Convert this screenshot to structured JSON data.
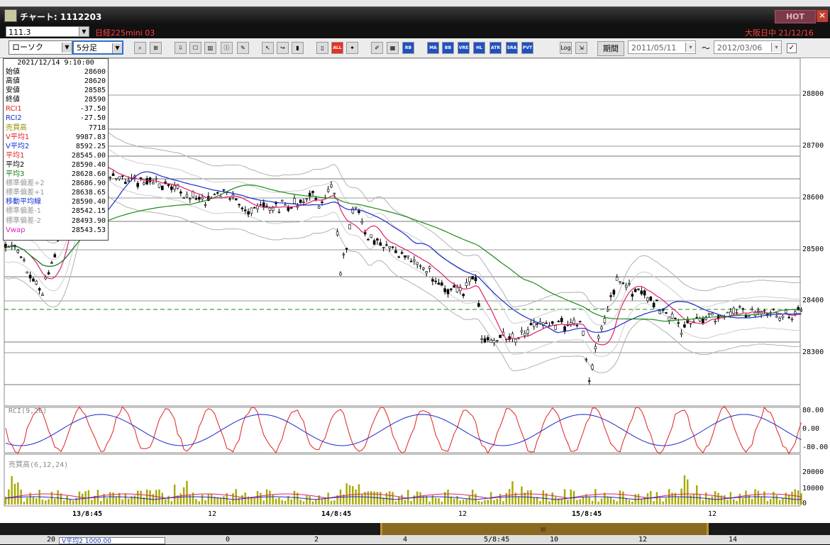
{
  "window": {
    "title": "チャート: 1112203",
    "hot_label": "HOT",
    "close_glyph": "✕"
  },
  "symbol_bar": {
    "code": "111.3",
    "name": "日経225mini 03",
    "market": "大阪日中  21/12/16"
  },
  "toolbar": {
    "chart_type": "ローソク",
    "interval": "5分足",
    "period_button": "期間",
    "start_date": "2011/05/11",
    "range_sep": "〜",
    "end_date": "2012/03/06",
    "buttons": [
      "zoom",
      "cross",
      "down",
      "cap",
      "up",
      "info",
      "edit",
      "pointer",
      "redo",
      "candle-a",
      "candle-b",
      "ALL",
      "config",
      "tools",
      "colors",
      "RCI",
      "MA",
      "BB",
      "VRE",
      "HL",
      "ATR",
      "SRA",
      "PVT",
      "Log",
      "export"
    ]
  },
  "info": {
    "datetime": "2021/12/14 9:10:00",
    "rows": [
      {
        "label": "始値",
        "value": "28600",
        "color": "black"
      },
      {
        "label": "高値",
        "value": "28620",
        "color": "black"
      },
      {
        "label": "安値",
        "value": "28585",
        "color": "black"
      },
      {
        "label": "終値",
        "value": "28590",
        "color": "black"
      },
      {
        "label": "RCI1",
        "value": "-37.50",
        "color": "red"
      },
      {
        "label": "RCI2",
        "value": "-27.50",
        "color": "blue"
      },
      {
        "label": "売買高",
        "value": "7718",
        "color": "olive"
      },
      {
        "label": "V平均1",
        "value": "9987.83",
        "color": "red"
      },
      {
        "label": "V平均2",
        "value": "8592.25",
        "color": "blue"
      },
      {
        "label": "平均1",
        "value": "28545.00",
        "color": "red"
      },
      {
        "label": "平均2",
        "value": "28590.40",
        "color": "black"
      },
      {
        "label": "平均3",
        "value": "28628.60",
        "color": "green"
      },
      {
        "label": "標準偏差+2",
        "value": "28686.90",
        "color": "grey"
      },
      {
        "label": "標準偏差+1",
        "value": "28638.65",
        "color": "grey"
      },
      {
        "label": "移動平均線",
        "value": "28590.40",
        "color": "blue"
      },
      {
        "label": "標準偏差-1",
        "value": "28542.15",
        "color": "grey"
      },
      {
        "label": "標準偏差-2",
        "value": "28493.90",
        "color": "grey"
      },
      {
        "label": "Vwap",
        "value": "28543.53",
        "color": "magenta"
      }
    ]
  },
  "price_axis": [
    "28800",
    "28700",
    "28600",
    "28500",
    "28400",
    "28300"
  ],
  "rci": {
    "label": "RCI(9,26)",
    "axis": [
      "80.00",
      "0.00",
      "-80.00"
    ]
  },
  "volume": {
    "label": "売買高(6,12,24)",
    "axis": [
      "20000",
      "10000",
      "0"
    ]
  },
  "x_axis": [
    {
      "label": "13/8:45",
      "bold": true
    },
    {
      "label": "12",
      "bold": false
    },
    {
      "label": "14/8:45",
      "bold": true
    },
    {
      "label": "12",
      "bold": false
    },
    {
      "label": "15/8:45",
      "bold": true
    },
    {
      "label": "12",
      "bold": false
    }
  ],
  "overview": {
    "handle": "III"
  },
  "bottom_labels": [
    "20",
    "0",
    "2",
    "4",
    "5/8:45",
    "10",
    "12",
    "14"
  ],
  "bottom_box": "V平均2   1000.00",
  "colors": {
    "up": "#ffffff",
    "down": "#000000",
    "ma1": "#e0206e",
    "ma2": "#1a2ad0",
    "ma3": "#1a8a1a",
    "band": "#b0b0b0",
    "rci1": "#e02020",
    "rci2": "#1a2ad0",
    "vol": "#a8a800",
    "hline": "#1a8a1a"
  }
}
